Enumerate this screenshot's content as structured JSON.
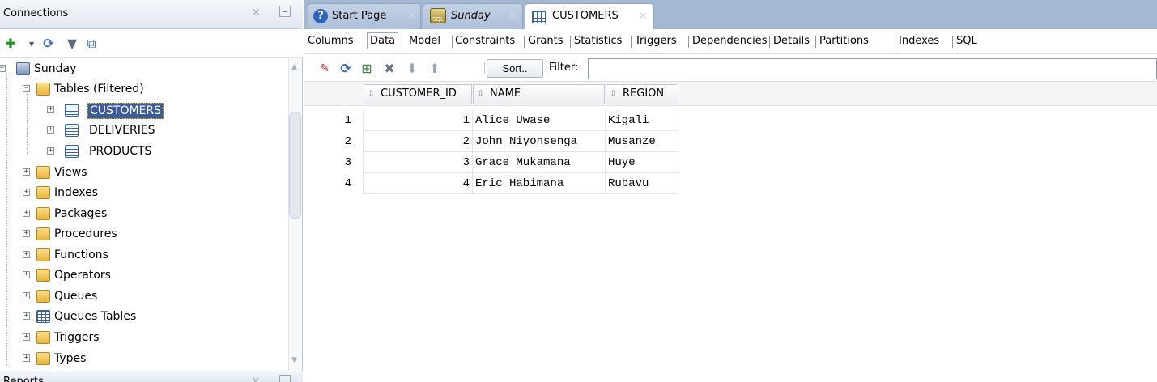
{
  "connections": {
    "title": "Connections",
    "close_glyph": "×",
    "toolbar": [
      {
        "name": "add-connection-icon",
        "glyph": "✚",
        "color": "#1e9a1e"
      },
      {
        "name": "dropdown-arrow-icon",
        "glyph": "▾",
        "color": "#555555"
      },
      {
        "name": "refresh-icon",
        "glyph": "⟳",
        "color": "#3f70b8"
      },
      {
        "name": "filter-icon",
        "glyph": "▼",
        "color": "#5a6a82"
      },
      {
        "name": "schema-browser-icon",
        "glyph": "⧉",
        "color": "#3f70b8"
      }
    ],
    "tree": {
      "root": "Sunday",
      "tables_folder": "Tables (Filtered)",
      "tables": [
        "CUSTOMERS",
        "DELIVERIES",
        "PRODUCTS"
      ],
      "folders": [
        "Views",
        "Indexes",
        "Packages",
        "Procedures",
        "Functions",
        "Operators",
        "Queues",
        "Queues Tables",
        "Triggers",
        "Types"
      ]
    }
  },
  "reports": {
    "title": "Reports",
    "close_glyph": "×"
  },
  "doc_tabs": [
    {
      "label": "Start Page",
      "icon": "help-icon"
    },
    {
      "label": "Sunday",
      "icon": "sql-worksheet-icon"
    },
    {
      "label": "CUSTOMERS",
      "icon": "table-icon"
    }
  ],
  "sub_tabs": [
    "Columns",
    "Data",
    "Model",
    "Constraints",
    "Grants",
    "Statistics",
    "Triggers",
    "Dependencies",
    "Details",
    "Partitions",
    "Indexes",
    "SQL"
  ],
  "active_sub_tab": "Data",
  "data_toolbar": {
    "sort_label": "Sort..",
    "filter_label": "Filter:",
    "filter_value": "",
    "icons": [
      {
        "name": "pin-icon",
        "glyph": "📌"
      },
      {
        "name": "refresh-icon",
        "glyph": "⟳"
      },
      {
        "name": "insert-row-icon",
        "glyph": "⊞"
      },
      {
        "name": "delete-row-icon",
        "glyph": "✖"
      },
      {
        "name": "commit-icon",
        "glyph": "⬇"
      },
      {
        "name": "rollback-icon",
        "glyph": "⬆"
      }
    ]
  },
  "grid": {
    "columns": [
      "CUSTOMER_ID",
      "NAME",
      "REGION"
    ],
    "rows": [
      {
        "num": "1",
        "customer_id": "1",
        "name": "Alice Uwase",
        "region": "Kigali"
      },
      {
        "num": "2",
        "customer_id": "2",
        "name": "John Niyonsenga",
        "region": "Musanze"
      },
      {
        "num": "3",
        "customer_id": "3",
        "name": "Grace Mukamana",
        "region": "Huye"
      },
      {
        "num": "4",
        "customer_id": "4",
        "name": "Eric Habimana",
        "region": "Rubavu"
      }
    ]
  }
}
